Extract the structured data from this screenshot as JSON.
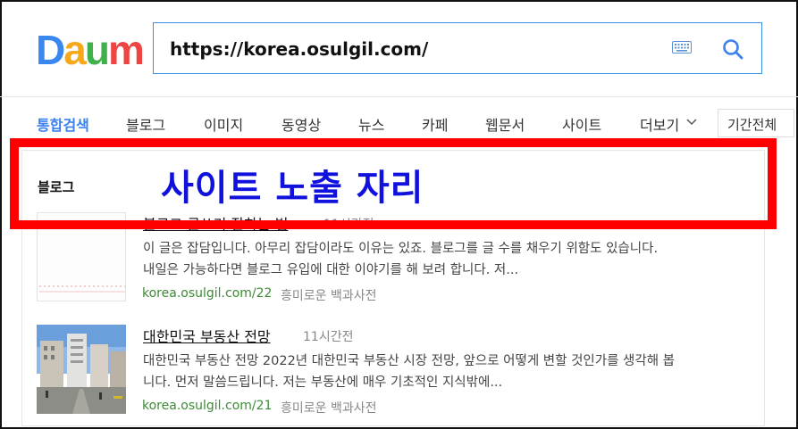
{
  "logo": {
    "letters": [
      "D",
      "a",
      "u",
      "m"
    ],
    "colors": [
      "#3a87f0",
      "#f7a81b",
      "#3fb04b",
      "#ee4444"
    ]
  },
  "search": {
    "value": "https://korea.osulgil.com/"
  },
  "tabs": [
    "통합검색",
    "블로그",
    "이미지",
    "동영상",
    "뉴스",
    "카페",
    "웹문서",
    "사이트",
    "더보기"
  ],
  "period_filter": "기간전체",
  "section": {
    "label": "블로그"
  },
  "overlay": {
    "label": "사이트 노출 자리",
    "color": "#ff0000"
  },
  "results": [
    {
      "title": "블로그 글쓰기 잘하는 법",
      "time": "11시간전",
      "snippet_lines": [
        "이 글은 잡담입니다. 아무리 잡담이라도 이유는 있죠. 블로그를 글 수를 채우기 위함도 있습니다.",
        "내일은 가능하다면 블로그 유입에 대한 이야기를 해 보려 합니다. 저..."
      ],
      "url": "korea.osulgil.com/22",
      "source": "흥미로운 백과사전"
    },
    {
      "title": "대한민국 부동산 전망",
      "time": "11시간전",
      "snippet_lines": [
        "대한민국 부동산 전망 2022년 대한민국 부동산 시장 전망, 앞으로 어떻게 변할 것인가를 생각해 봅",
        "니다. 먼저 말씀드립니다. 저는 부동산에 매우 기초적인 지식밖에..."
      ],
      "url": "korea.osulgil.com/21",
      "source": "흥미로운 백과사전"
    }
  ]
}
